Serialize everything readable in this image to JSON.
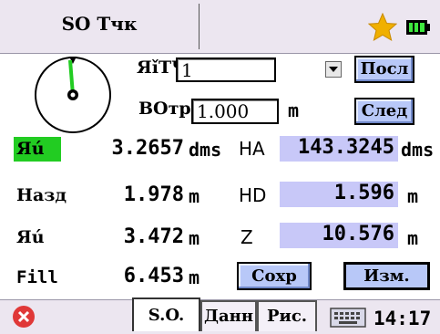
{
  "header": {
    "title": "SO Тчк"
  },
  "icons": {
    "star": "star-icon",
    "battery": "battery-icon",
    "close": "close-icon",
    "keyboard": "keyboard-icon",
    "compass": "compass-icon",
    "dropdown": "chevron-down-icon"
  },
  "colors": {
    "accent_green": "#22cc22",
    "field_purple": "#c8c8f8",
    "button_blue": "#b8c8f8",
    "close_red": "#e03838"
  },
  "point": {
    "label": "ЯǐТЧ",
    "value": "1"
  },
  "height": {
    "label": "ВОтр",
    "value": "1.000",
    "unit": "m"
  },
  "buttons": {
    "prev": "Посл",
    "next": "След",
    "save": "Сохр",
    "edit": "Изм."
  },
  "rows": [
    {
      "label": "Яú",
      "value": "3.2657",
      "unit": "dms",
      "right_label": "HA",
      "right_value": "143.3245",
      "right_unit": "dms"
    },
    {
      "label": "Назд",
      "value": "1.978",
      "unit": "m",
      "right_label": "HD",
      "right_value": "1.596",
      "right_unit": "m"
    },
    {
      "label": "Яú",
      "value": "3.472",
      "unit": "m",
      "right_label": "Z",
      "right_value": "10.576",
      "right_unit": "m"
    },
    {
      "label": "Fill",
      "value": "6.453",
      "unit": "m"
    }
  ],
  "tabs": [
    {
      "label": "S.O."
    },
    {
      "label": "Данн"
    },
    {
      "label": "Рис."
    }
  ],
  "clock": "14:17"
}
